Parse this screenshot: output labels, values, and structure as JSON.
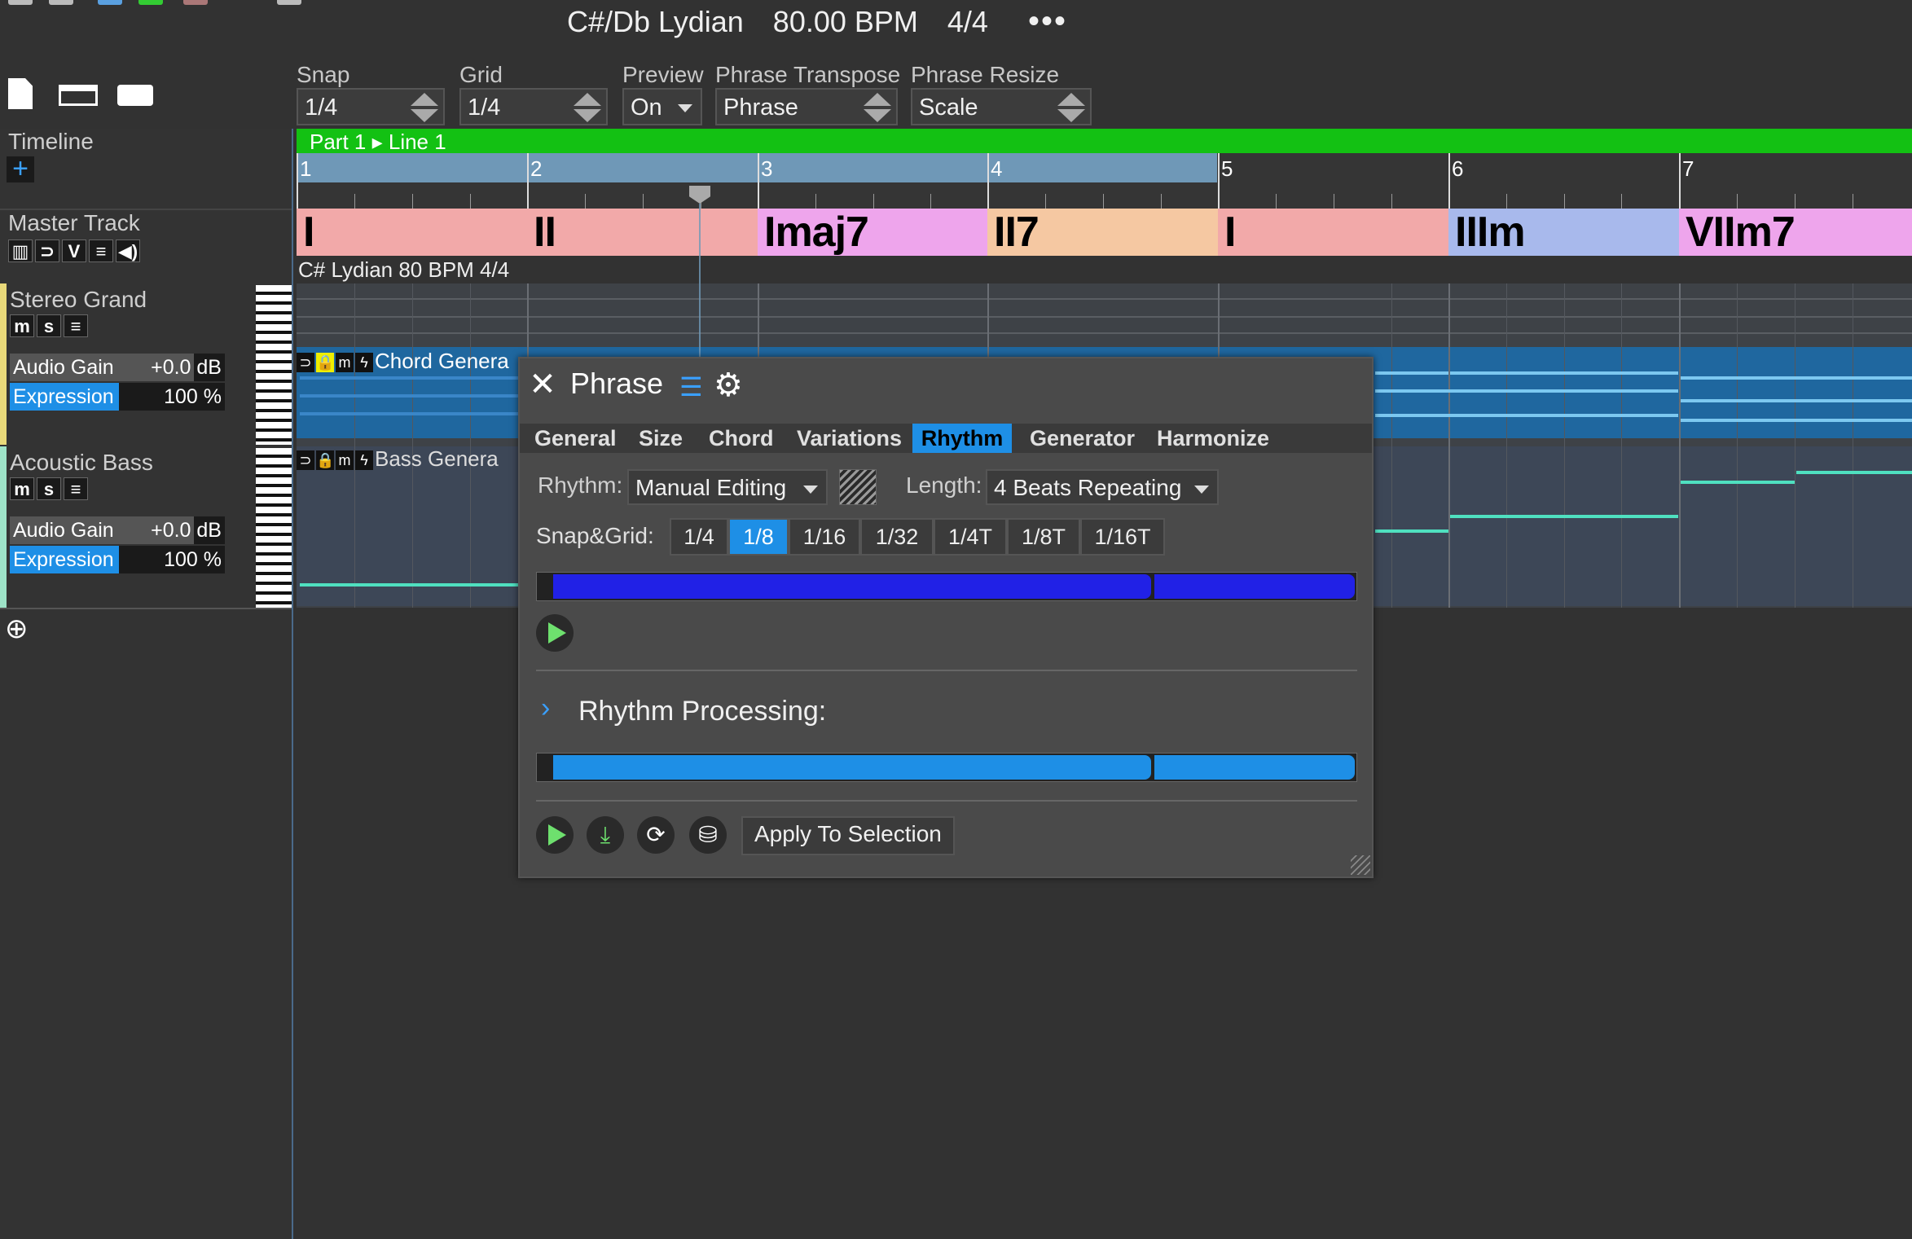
{
  "header": {
    "key": "C#/Db Lydian",
    "tempo": "80.00 BPM",
    "meter": "4/4",
    "more_icon": "•••"
  },
  "toolbar": {
    "snap": {
      "label": "Snap",
      "value": "1/4"
    },
    "grid": {
      "label": "Grid",
      "value": "1/4"
    },
    "preview": {
      "label": "Preview",
      "value": "On"
    },
    "phrase_transpose": {
      "label": "Phrase Transpose",
      "value": "Phrase"
    },
    "phrase_resize": {
      "label": "Phrase Resize",
      "value": "Scale"
    }
  },
  "left_panel": {
    "timeline_label": "Timeline",
    "master_track_label": "Master Track",
    "master_buttons": [
      "▥",
      "⊃",
      "V",
      "≡",
      "◀)"
    ],
    "tracks": [
      {
        "name": "Stereo Grand",
        "buttons": [
          "m",
          "s",
          "≡"
        ],
        "gain_label": "Audio Gain",
        "gain_value": "+0.0",
        "gain_unit": "dB",
        "expr_label": "Expression",
        "expr_value": "100 %"
      },
      {
        "name": "Acoustic Bass",
        "buttons": [
          "m",
          "s",
          "≡"
        ],
        "gain_label": "Audio Gain",
        "gain_value": "+0.0",
        "gain_unit": "dB",
        "expr_label": "Expression",
        "expr_value": "100 %"
      }
    ],
    "add_track_icon": "⊕"
  },
  "timeline": {
    "part_label": "Part 1 ▸ Line 1",
    "bars": [
      "1",
      "2",
      "3",
      "4",
      "5",
      "6",
      "7"
    ],
    "key_label": "C# Lydian 80 BPM 4/4"
  },
  "chords": [
    {
      "label": "I",
      "color": "#f2a9a9"
    },
    {
      "label": "II",
      "color": "#f2a9a9"
    },
    {
      "label": "Imaj7",
      "color": "#eea5ec"
    },
    {
      "label": "II7",
      "color": "#f5c8a2"
    },
    {
      "label": "I",
      "color": "#f2a9a9"
    },
    {
      "label": "IIIm",
      "color": "#a8b9ec"
    },
    {
      "label": "VIIm7",
      "color": "#eea5ec"
    }
  ],
  "regions": {
    "chord": "Chord Genera",
    "bass": "Bass Genera"
  },
  "dialog": {
    "title": "Phrase",
    "tabs": [
      "General",
      "Size",
      "Chord",
      "Variations",
      "Rhythm",
      "Generator",
      "Harmonize"
    ],
    "active_tab": "Rhythm",
    "rhythm_label": "Rhythm:",
    "rhythm_value": "Manual Editing",
    "length_label": "Length:",
    "length_value": "4 Beats Repeating",
    "snapgrid_label": "Snap&Grid:",
    "snapgrid_options": [
      "1/4",
      "1/8",
      "1/16",
      "1/32",
      "1/4T",
      "1/8T",
      "1/16T"
    ],
    "snapgrid_active": "1/8",
    "processing_label": "Rhythm Processing:",
    "apply_label": "Apply To Selection"
  },
  "colors": {
    "accent": "#1e8fe6",
    "timeline_green": "#13c113",
    "rhythm_bar": "#2121e6",
    "processing_bar": "#1e8fe6"
  }
}
